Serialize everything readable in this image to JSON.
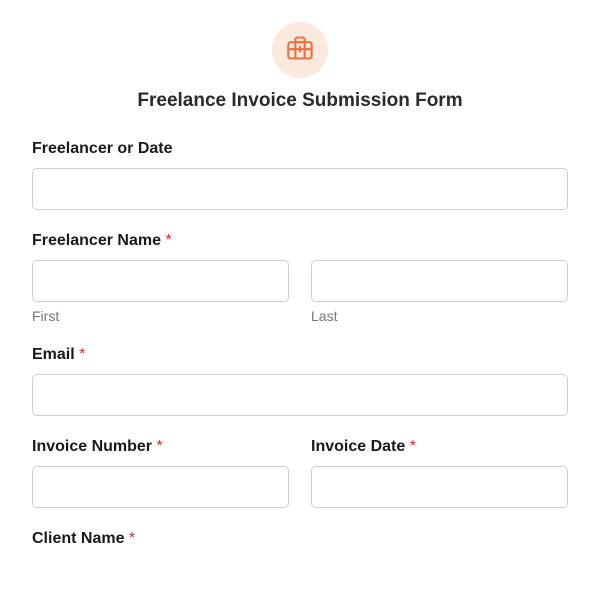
{
  "header": {
    "title": "Freelance Invoice Submission Form",
    "icon": "briefcase-icon",
    "icon_color": "#e8733c",
    "icon_bg": "#fce9dd"
  },
  "fields": {
    "freelancer_or_date": {
      "label": "Freelancer or Date",
      "required": false,
      "value": ""
    },
    "freelancer_name": {
      "label": "Freelancer Name",
      "required": true,
      "first": {
        "value": "",
        "sublabel": "First"
      },
      "last": {
        "value": "",
        "sublabel": "Last"
      }
    },
    "email": {
      "label": "Email",
      "required": true,
      "value": ""
    },
    "invoice_number": {
      "label": "Invoice Number",
      "required": true,
      "value": ""
    },
    "invoice_date": {
      "label": "Invoice Date",
      "required": true,
      "value": ""
    },
    "client_name": {
      "label": "Client Name",
      "required": true,
      "value": ""
    }
  },
  "required_marker": "*"
}
